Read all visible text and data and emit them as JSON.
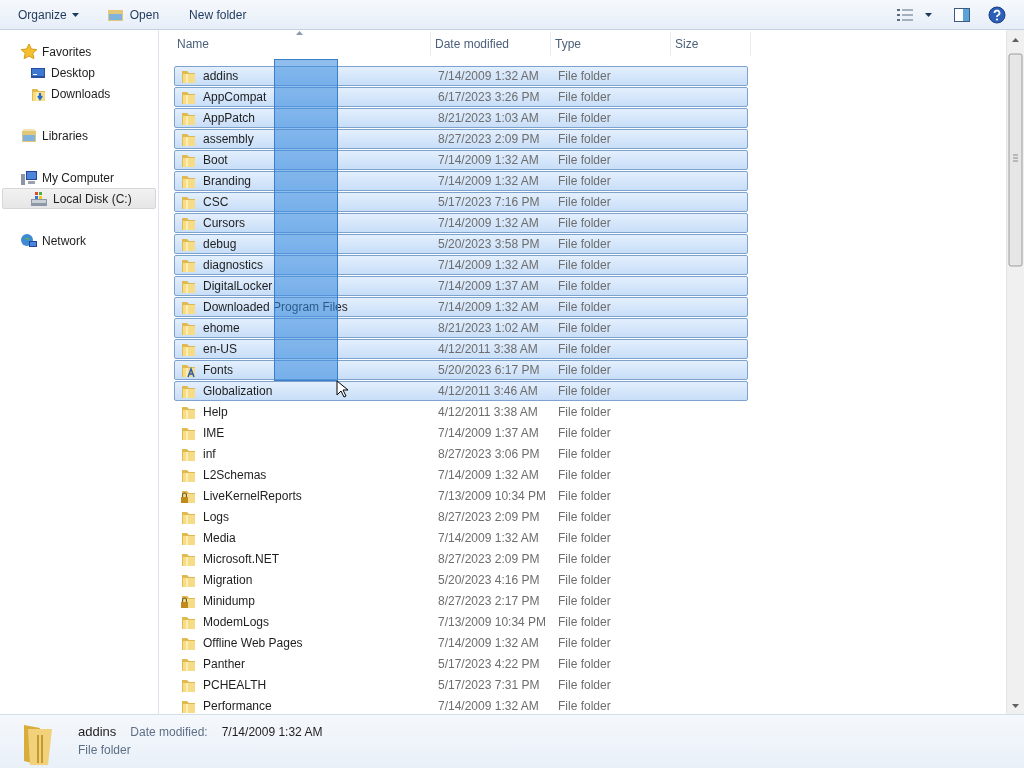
{
  "toolbar": {
    "organize": "Organize",
    "open": "Open",
    "new_folder": "New folder"
  },
  "navigation": [
    {
      "label": "Favorites",
      "kind": "star",
      "selected": false,
      "children": [
        {
          "label": "Desktop",
          "kind": "desktop",
          "selected": false
        },
        {
          "label": "Downloads",
          "kind": "downloads",
          "selected": false
        }
      ]
    },
    {
      "label": "Libraries",
      "kind": "library",
      "selected": false
    },
    {
      "label": "My Computer",
      "kind": "computer",
      "selected": false,
      "children": [
        {
          "label": "Local Disk (C:)",
          "kind": "disk",
          "selected": true
        }
      ]
    },
    {
      "label": "Network",
      "kind": "network",
      "selected": false
    }
  ],
  "columns": [
    "Name",
    "Date modified",
    "Type",
    "Size"
  ],
  "rows": [
    {
      "name": "addins",
      "date": "7/14/2009 1:32 AM",
      "type": "File folder",
      "kind": "folder",
      "selected": true
    },
    {
      "name": "AppCompat",
      "date": "6/17/2023 3:26 PM",
      "type": "File folder",
      "kind": "folder",
      "selected": true
    },
    {
      "name": "AppPatch",
      "date": "8/21/2023 1:03 AM",
      "type": "File folder",
      "kind": "folder",
      "selected": true
    },
    {
      "name": "assembly",
      "date": "8/27/2023 2:09 PM",
      "type": "File folder",
      "kind": "folder",
      "selected": true
    },
    {
      "name": "Boot",
      "date": "7/14/2009 1:32 AM",
      "type": "File folder",
      "kind": "folder",
      "selected": true
    },
    {
      "name": "Branding",
      "date": "7/14/2009 1:32 AM",
      "type": "File folder",
      "kind": "folder",
      "selected": true
    },
    {
      "name": "CSC",
      "date": "5/17/2023 7:16 PM",
      "type": "File folder",
      "kind": "folder",
      "selected": true
    },
    {
      "name": "Cursors",
      "date": "7/14/2009 1:32 AM",
      "type": "File folder",
      "kind": "folder",
      "selected": true
    },
    {
      "name": "debug",
      "date": "5/20/2023 3:58 PM",
      "type": "File folder",
      "kind": "folder",
      "selected": true
    },
    {
      "name": "diagnostics",
      "date": "7/14/2009 1:32 AM",
      "type": "File folder",
      "kind": "folder",
      "selected": true
    },
    {
      "name": "DigitalLocker",
      "date": "7/14/2009 1:37 AM",
      "type": "File folder",
      "kind": "folder",
      "selected": true
    },
    {
      "name": "Downloaded Program Files",
      "date": "7/14/2009 1:32 AM",
      "type": "File folder",
      "kind": "folder",
      "selected": true
    },
    {
      "name": "ehome",
      "date": "8/21/2023 1:02 AM",
      "type": "File folder",
      "kind": "folder",
      "selected": true
    },
    {
      "name": "en-US",
      "date": "4/12/2011 3:38 AM",
      "type": "File folder",
      "kind": "folder",
      "selected": true
    },
    {
      "name": "Fonts",
      "date": "5/20/2023 6:17 PM",
      "type": "File folder",
      "kind": "fonts",
      "selected": true
    },
    {
      "name": "Globalization",
      "date": "4/12/2011 3:46 AM",
      "type": "File folder",
      "kind": "folder",
      "selected": true
    },
    {
      "name": "Help",
      "date": "4/12/2011 3:38 AM",
      "type": "File folder",
      "kind": "folder",
      "selected": false
    },
    {
      "name": "IME",
      "date": "7/14/2009 1:37 AM",
      "type": "File folder",
      "kind": "folder",
      "selected": false
    },
    {
      "name": "inf",
      "date": "8/27/2023 3:06 PM",
      "type": "File folder",
      "kind": "folder",
      "selected": false
    },
    {
      "name": "L2Schemas",
      "date": "7/14/2009 1:32 AM",
      "type": "File folder",
      "kind": "folder",
      "selected": false
    },
    {
      "name": "LiveKernelReports",
      "date": "7/13/2009 10:34 PM",
      "type": "File folder",
      "kind": "locked",
      "selected": false
    },
    {
      "name": "Logs",
      "date": "8/27/2023 2:09 PM",
      "type": "File folder",
      "kind": "folder",
      "selected": false
    },
    {
      "name": "Media",
      "date": "7/14/2009 1:32 AM",
      "type": "File folder",
      "kind": "folder",
      "selected": false
    },
    {
      "name": "Microsoft.NET",
      "date": "8/27/2023 2:09 PM",
      "type": "File folder",
      "kind": "folder",
      "selected": false
    },
    {
      "name": "Migration",
      "date": "5/20/2023 4:16 PM",
      "type": "File folder",
      "kind": "folder",
      "selected": false
    },
    {
      "name": "Minidump",
      "date": "8/27/2023 2:17 PM",
      "type": "File folder",
      "kind": "locked",
      "selected": false
    },
    {
      "name": "ModemLogs",
      "date": "7/13/2009 10:34 PM",
      "type": "File folder",
      "kind": "folder",
      "selected": false
    },
    {
      "name": "Offline Web Pages",
      "date": "7/14/2009 1:32 AM",
      "type": "File folder",
      "kind": "folder",
      "selected": false
    },
    {
      "name": "Panther",
      "date": "5/17/2023 4:22 PM",
      "type": "File folder",
      "kind": "folder",
      "selected": false
    },
    {
      "name": "PCHEALTH",
      "date": "5/17/2023 7:31 PM",
      "type": "File folder",
      "kind": "folder",
      "selected": false
    },
    {
      "name": "Performance",
      "date": "7/14/2009 1:32 AM",
      "type": "File folder",
      "kind": "folder",
      "selected": false
    }
  ],
  "details": {
    "name": "addins",
    "date_label": "Date modified:",
    "date": "7/14/2009 1:32 AM",
    "type": "File folder"
  }
}
